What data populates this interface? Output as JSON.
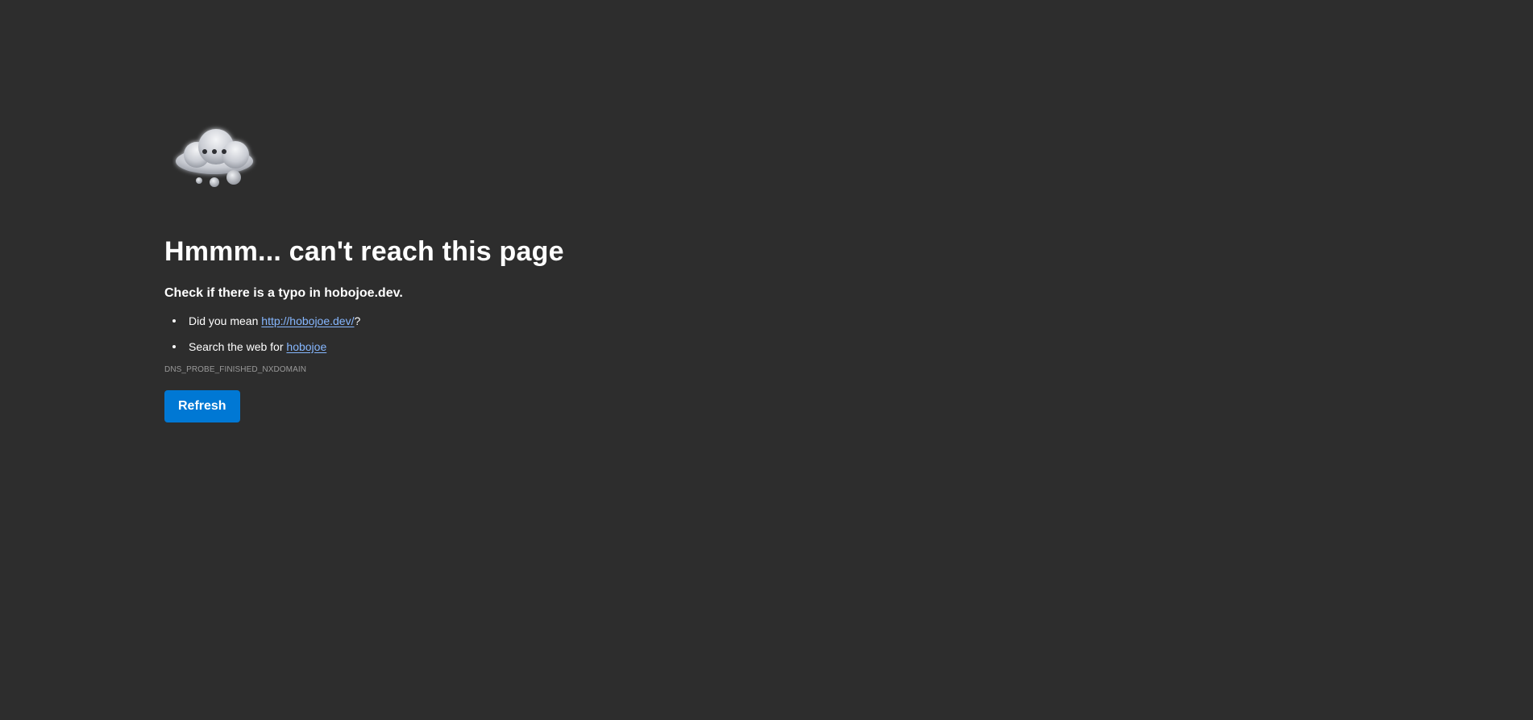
{
  "icon": {
    "name": "thinking-cloud-icon"
  },
  "heading": "Hmmm... can't reach this page",
  "subtitle": "Check if there is a typo in hobojoe.dev.",
  "suggestions": [
    {
      "prefix": "Did you mean ",
      "link": "http://hobojoe.dev/",
      "suffix": "?"
    },
    {
      "prefix": "Search the web for ",
      "link": "hobojoe",
      "suffix": ""
    }
  ],
  "error_code": "DNS_PROBE_FINISHED_NXDOMAIN",
  "refresh_label": "Refresh",
  "colors": {
    "background": "#2d2d2d",
    "accent": "#0078d4",
    "link": "#86b7ff"
  }
}
